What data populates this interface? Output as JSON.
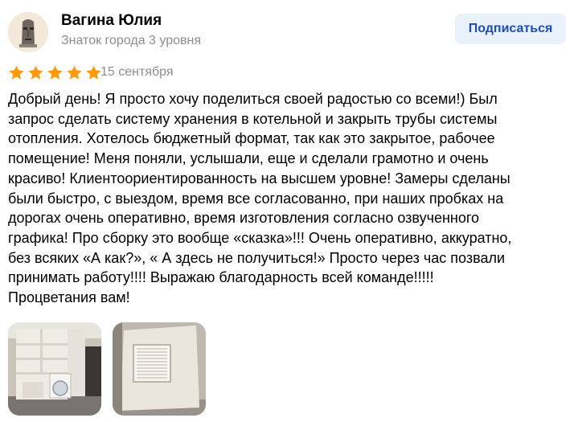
{
  "author": {
    "name": "Вагина Юлия",
    "level": "Знаток города 3 уровня",
    "avatar_icon": "moai-statue-avatar"
  },
  "subscribe_label": "Подписаться",
  "rating": {
    "value": 5,
    "max": 5,
    "star_color": "#fc9b0e"
  },
  "date": "15 сентября",
  "review_text": "Добрый день! Я просто хочу поделиться своей радостью со всеми!) Был\nзапрос сделать систему хранения в котельной и закрыть трубы системы\nотопления. Хотелось бюджетный формат, так как это закрытое, рабочее\nпомещение! Меня поняли, услышали, еще и сделали грамотно и очень\nкрасиво! Клиентоориентированность на высшем уровне! Замеры сделаны\nбыли быстро, с выездом, время все согласованно, при наших пробках на\nдорогах очень оперативно, время изготовления согласно озвученного\nграфика! Про сборку это вообще «сказка»!!! Очень оперативно, аккуратно,\nбез всяких «А как?», « А здесь не получиться!» Просто через час позвали\nпринимать работу!!!! Выражаю благодарность всей команде!!!!!\nПроцветания вам!",
  "photos": [
    {
      "icon": "shelving-with-washing-machine-photo"
    },
    {
      "icon": "boxed-pipes-with-vent-grille-photo"
    }
  ],
  "colors": {
    "accent": "#1e4fb5",
    "button_bg": "#eaf1fb",
    "muted_text": "#8c8c8c"
  }
}
